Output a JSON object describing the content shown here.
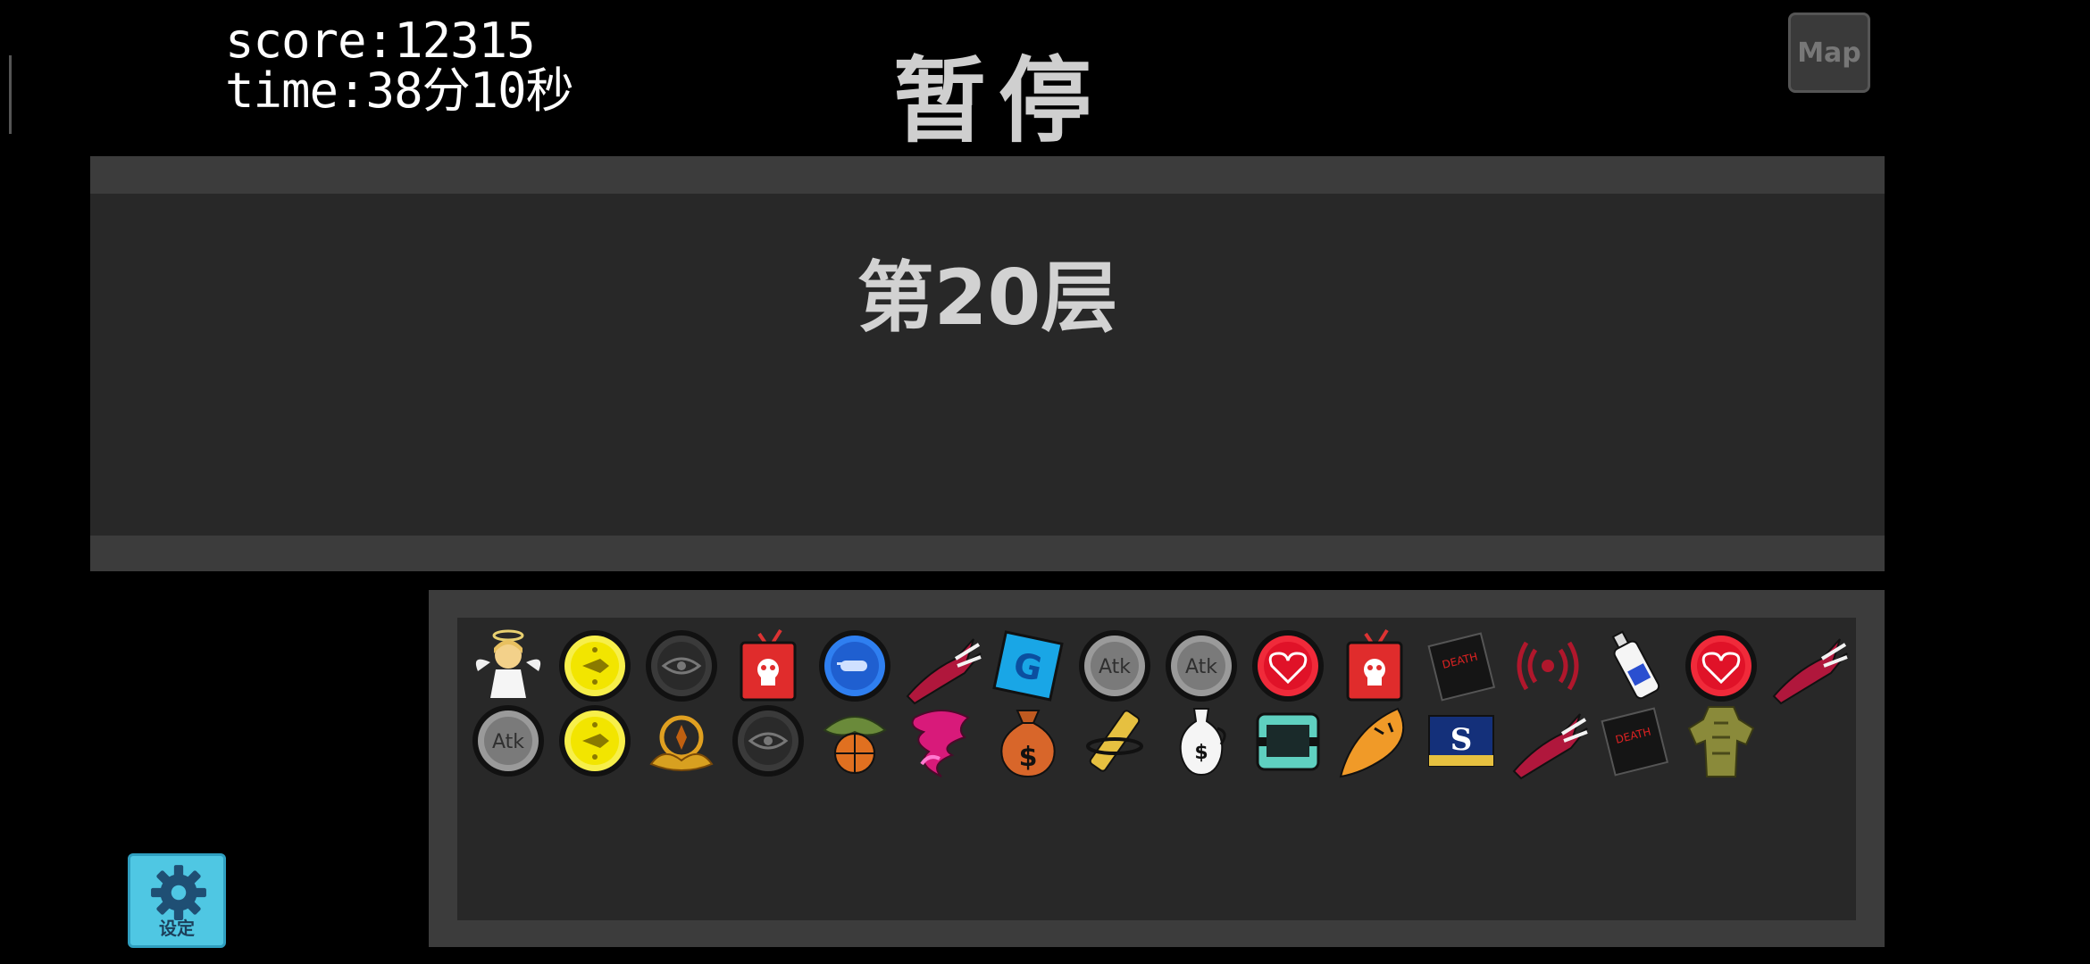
{
  "hud": {
    "score_text": "score:12315",
    "time_text": "time:38分10秒"
  },
  "title": "暂停",
  "map_button_label": "Map",
  "floor_label": "第20层",
  "settings_label": "设定",
  "items": {
    "row1": [
      {
        "name": "angel-icon"
      },
      {
        "name": "yellow-bullet-coin-icon"
      },
      {
        "name": "eye-coin-icon"
      },
      {
        "name": "poison-tv-icon"
      },
      {
        "name": "blue-bullet-coin-icon"
      },
      {
        "name": "red-squid-claw-icon"
      },
      {
        "name": "g-badge-icon"
      },
      {
        "name": "atk-coin-icon",
        "text": "Atk"
      },
      {
        "name": "atk-coin-icon",
        "text": "Atk"
      },
      {
        "name": "heart-coin-icon"
      },
      {
        "name": "poison-tv-icon"
      },
      {
        "name": "death-book-icon",
        "text": "DEATH"
      },
      {
        "name": "red-signal-icon"
      },
      {
        "name": "spray-bottle-icon"
      },
      {
        "name": "heart-coin-icon"
      },
      {
        "name": "red-squid-claw-icon"
      }
    ],
    "row2": [
      {
        "name": "atk-coin-icon",
        "text": "Atk"
      },
      {
        "name": "yellow-bullet-coin-icon"
      },
      {
        "name": "golden-lotus-icon"
      },
      {
        "name": "eye-coin-icon"
      },
      {
        "name": "basketball-leaf-icon"
      },
      {
        "name": "pink-tornado-icon"
      },
      {
        "name": "money-bag-icon",
        "text": "$"
      },
      {
        "name": "golden-bone-icon"
      },
      {
        "name": "white-vase-icon",
        "text": "$"
      },
      {
        "name": "teal-chest-icon"
      },
      {
        "name": "angry-leaf-icon"
      },
      {
        "name": "s-card-icon",
        "text": "S"
      },
      {
        "name": "red-squid-claw-icon"
      },
      {
        "name": "death-book-icon",
        "text": "DEATH"
      },
      {
        "name": "olive-armor-icon"
      }
    ]
  },
  "colors": {
    "background": "#000000",
    "panel": "#282828",
    "panel_stripe": "#3c3c3c",
    "settings_accent": "#4fc7e3"
  }
}
